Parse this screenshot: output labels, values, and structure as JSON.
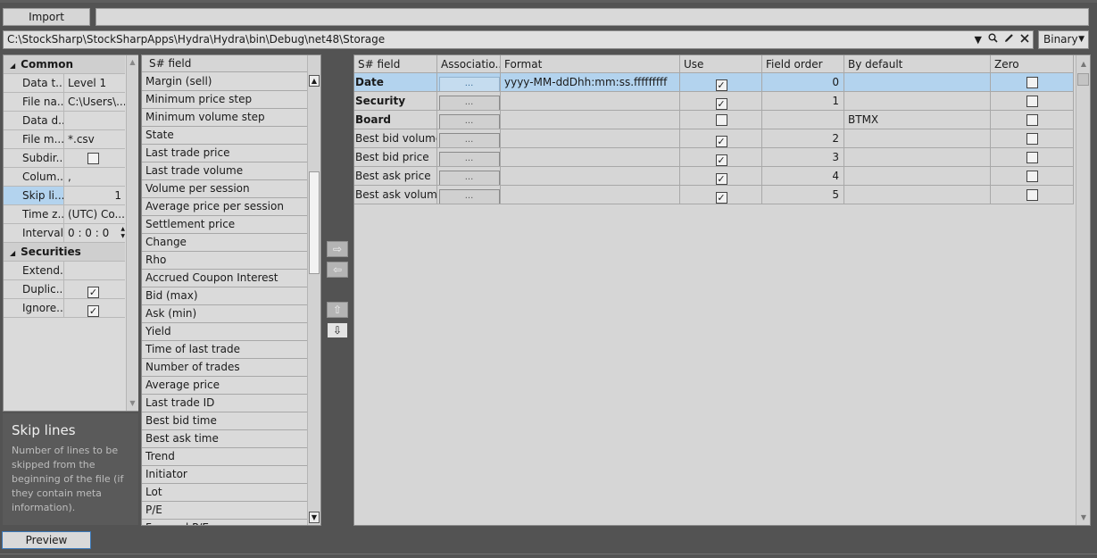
{
  "toolbar": {
    "import_label": "Import"
  },
  "path": {
    "value": "C:\\StockSharp\\StockSharpApps\\Hydra\\Hydra\\bin\\Debug\\net48\\Storage",
    "icons": [
      "chevron-down-icon",
      "search-icon",
      "pencil-icon",
      "close-icon"
    ]
  },
  "format_select": {
    "selected": "Binary"
  },
  "properties": {
    "category_common": "Common",
    "category_securities": "Securities",
    "rows": [
      {
        "name": "Data t...",
        "value": "Level 1"
      },
      {
        "name": "File na...",
        "value": "C:\\Users\\..."
      },
      {
        "name": "Data d...",
        "value": ""
      },
      {
        "name": "File m...",
        "value": "*.csv"
      },
      {
        "name": "Subdir...",
        "value": ""
      },
      {
        "name": "Colum...",
        "value": ","
      },
      {
        "name": "Skip li...",
        "value": "1"
      },
      {
        "name": "Time z...",
        "value": "(UTC) Co..."
      },
      {
        "name": "Interval",
        "value": "0 : 0 : 0"
      }
    ],
    "securities_rows": [
      {
        "name": "Extend...",
        "value": ""
      },
      {
        "name": "Duplic...",
        "value": ""
      },
      {
        "name": "Ignore...",
        "value": ""
      }
    ]
  },
  "description": {
    "title": "Skip lines",
    "text": "Number of lines to be skipped from the beginning of the file (if they contain meta information)."
  },
  "field_list": {
    "header": "S# field",
    "items": [
      "Margin (sell)",
      "Minimum price step",
      "Minimum volume step",
      "State",
      "Last trade price",
      "Last trade volume",
      "Volume per session",
      "Average price per session",
      "Settlement price",
      "Change",
      "Rho",
      "Accrued Coupon Interest",
      "Bid (max)",
      "Ask (min)",
      "Yield",
      "Time of last trade",
      "Number of trades",
      "Average price",
      "Last trade ID",
      "Best bid time",
      "Best ask time",
      "Trend",
      "Initiator",
      "Lot",
      "P/E",
      "Forward P/E"
    ]
  },
  "grid": {
    "columns": [
      "S# field",
      "Associatio...",
      "Format",
      "Use",
      "Field order",
      "By default",
      "Zero"
    ],
    "assoc_label": "...",
    "rows": [
      {
        "field": "Date",
        "bold": true,
        "format": "yyyy-MM-ddDhh:mm:ss.fffffffff",
        "use": true,
        "order": "0",
        "default": "",
        "zero": false
      },
      {
        "field": "Security",
        "bold": true,
        "format": "",
        "use": true,
        "order": "1",
        "default": "",
        "zero": false
      },
      {
        "field": "Board",
        "bold": true,
        "format": "",
        "use": false,
        "order": "",
        "default": "BTMX",
        "zero": false
      },
      {
        "field": "Best bid volume",
        "bold": false,
        "format": "",
        "use": true,
        "order": "2",
        "default": "",
        "zero": false
      },
      {
        "field": "Best bid price",
        "bold": false,
        "format": "",
        "use": true,
        "order": "3",
        "default": "",
        "zero": false
      },
      {
        "field": "Best ask price",
        "bold": false,
        "format": "",
        "use": true,
        "order": "4",
        "default": "",
        "zero": false
      },
      {
        "field": "Best ask volume",
        "bold": false,
        "format": "",
        "use": true,
        "order": "5",
        "default": "",
        "zero": false
      }
    ]
  },
  "footer": {
    "preview_label": "Preview"
  },
  "colors": {
    "accent": "#b3d3ee",
    "background": "#535353",
    "panel": "#dadada"
  }
}
